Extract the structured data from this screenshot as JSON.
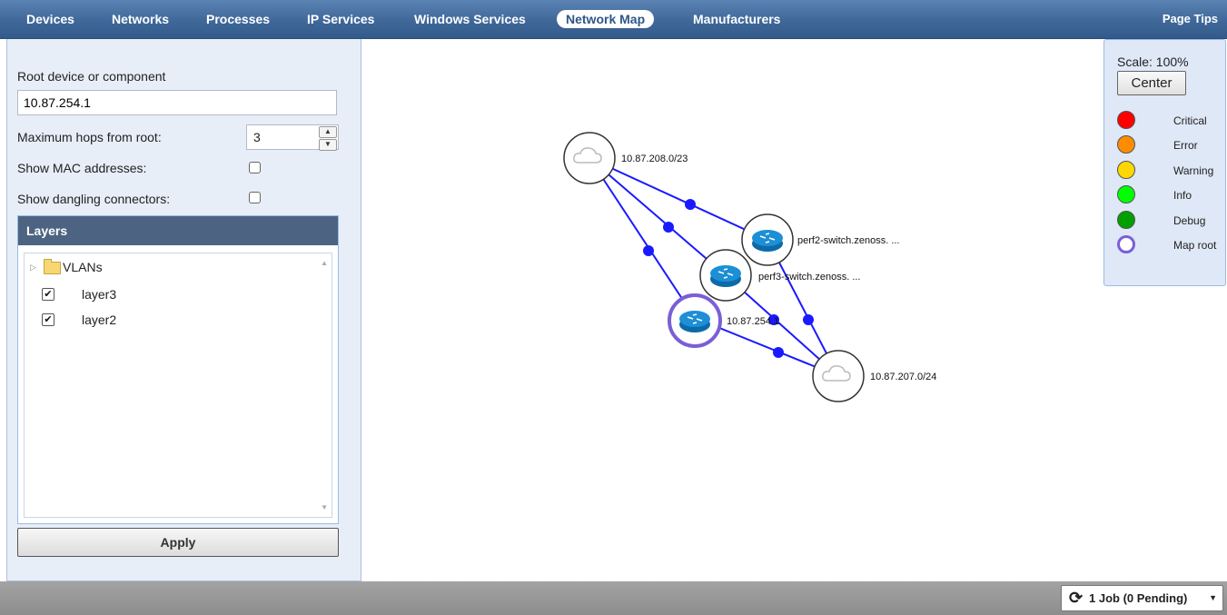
{
  "nav": {
    "tabs": [
      {
        "label": "Devices"
      },
      {
        "label": "Networks"
      },
      {
        "label": "Processes"
      },
      {
        "label": "IP Services"
      },
      {
        "label": "Windows Services"
      },
      {
        "label": "Network Map"
      },
      {
        "label": "Manufacturers"
      }
    ],
    "active_tab": "Network Map",
    "page_tips": "Page Tips"
  },
  "left_panel": {
    "root_label": "Root device or component",
    "root_value": "10.87.254.1",
    "hops_label": "Maximum hops from root:",
    "hops_value": "3",
    "show_mac_label": "Show MAC addresses:",
    "show_mac_checked": false,
    "show_dangling_label": "Show dangling connectors:",
    "show_dangling_checked": false,
    "layers": {
      "title": "Layers",
      "items": [
        {
          "label": "VLANs",
          "type": "folder",
          "collapsed": true
        },
        {
          "label": "layer3",
          "type": "check",
          "checked": true
        },
        {
          "label": "layer2",
          "type": "check",
          "checked": true
        }
      ]
    },
    "apply_label": "Apply"
  },
  "map": {
    "nodes": [
      {
        "label": "10.87.208.0/23",
        "kind": "network"
      },
      {
        "label": "perf2-switch.zenoss. ...",
        "kind": "router"
      },
      {
        "label": "perf3-switch.zenoss. ...",
        "kind": "router"
      },
      {
        "label": "10.87.254.1",
        "kind": "router",
        "is_root": true
      },
      {
        "label": "10.87.207.0/24",
        "kind": "network"
      }
    ],
    "link_color": "#1a1aff",
    "root_ring_color": "#7a5fd6"
  },
  "legend": {
    "scale_text": "Scale: 100%",
    "center_label": "Center",
    "items": [
      {
        "label": "Critical",
        "color": "#ff0000"
      },
      {
        "label": "Error",
        "color": "#ff8c00"
      },
      {
        "label": "Warning",
        "color": "#ffd700"
      },
      {
        "label": "Info",
        "color": "#00ff00"
      },
      {
        "label": "Debug",
        "color": "#00a000"
      },
      {
        "label": "Map root",
        "color": "#7a5fd6"
      }
    ]
  },
  "status_bar": {
    "jobs_label": "1 Job (0 Pending)"
  }
}
